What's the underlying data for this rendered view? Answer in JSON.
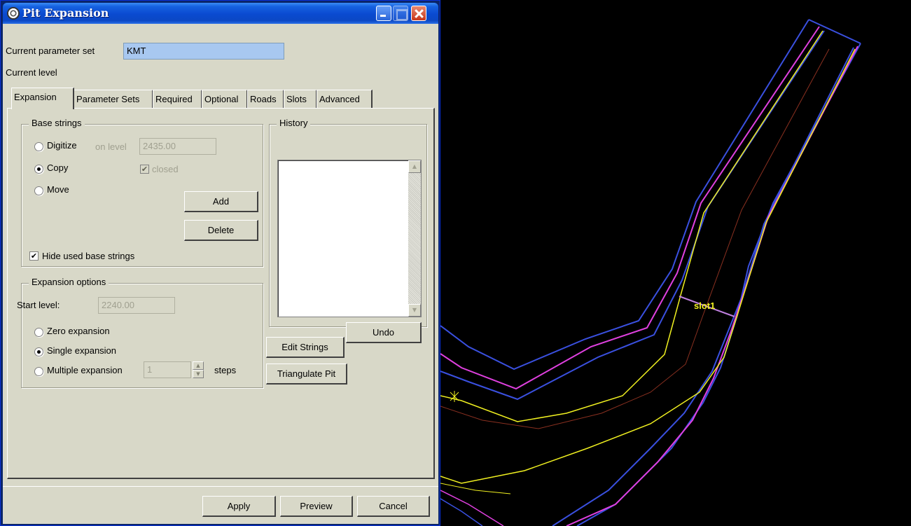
{
  "window": {
    "title": "Pit Expansion"
  },
  "header": {
    "param_set_label": "Current parameter set",
    "param_set_value": "KMT",
    "current_level_label": "Current level"
  },
  "tabs": [
    "Expansion",
    "Parameter Sets",
    "Required",
    "Optional",
    "Roads",
    "Slots",
    "Advanced"
  ],
  "active_tab": "Expansion",
  "base_strings": {
    "title": "Base strings",
    "digitize_label": "Digitize",
    "copy_label": "Copy",
    "move_label": "Move",
    "selected": "Copy",
    "on_level_label": "on level",
    "on_level_value": "2435.00",
    "closed_label": "closed",
    "closed_checked": true,
    "add_label": "Add",
    "delete_label": "Delete",
    "hide_used_label": "Hide used base strings",
    "hide_used_checked": true
  },
  "history": {
    "title": "History",
    "items": [],
    "undo_label": "Undo"
  },
  "side_buttons": {
    "edit_strings": "Edit Strings",
    "triangulate_pit": "Triangulate Pit"
  },
  "expansion_options": {
    "title": "Expansion options",
    "start_level_label": "Start level:",
    "start_level_value": "2240.00",
    "zero_label": "Zero expansion",
    "single_label": "Single expansion",
    "multiple_label": "Multiple expansion",
    "selected": "Single expansion",
    "steps_value": "1",
    "steps_label": "steps"
  },
  "footer": {
    "apply": "Apply",
    "preview": "Preview",
    "cancel": "Cancel"
  },
  "viewport": {
    "slot_label": "slot1",
    "colors": {
      "background": "#000000",
      "outer_strings": "#3a50e0",
      "pit_strings": "#e040e0",
      "crest_strings": "#f0f020",
      "center_line": "#8a3020",
      "marker": "#f0f020"
    }
  }
}
